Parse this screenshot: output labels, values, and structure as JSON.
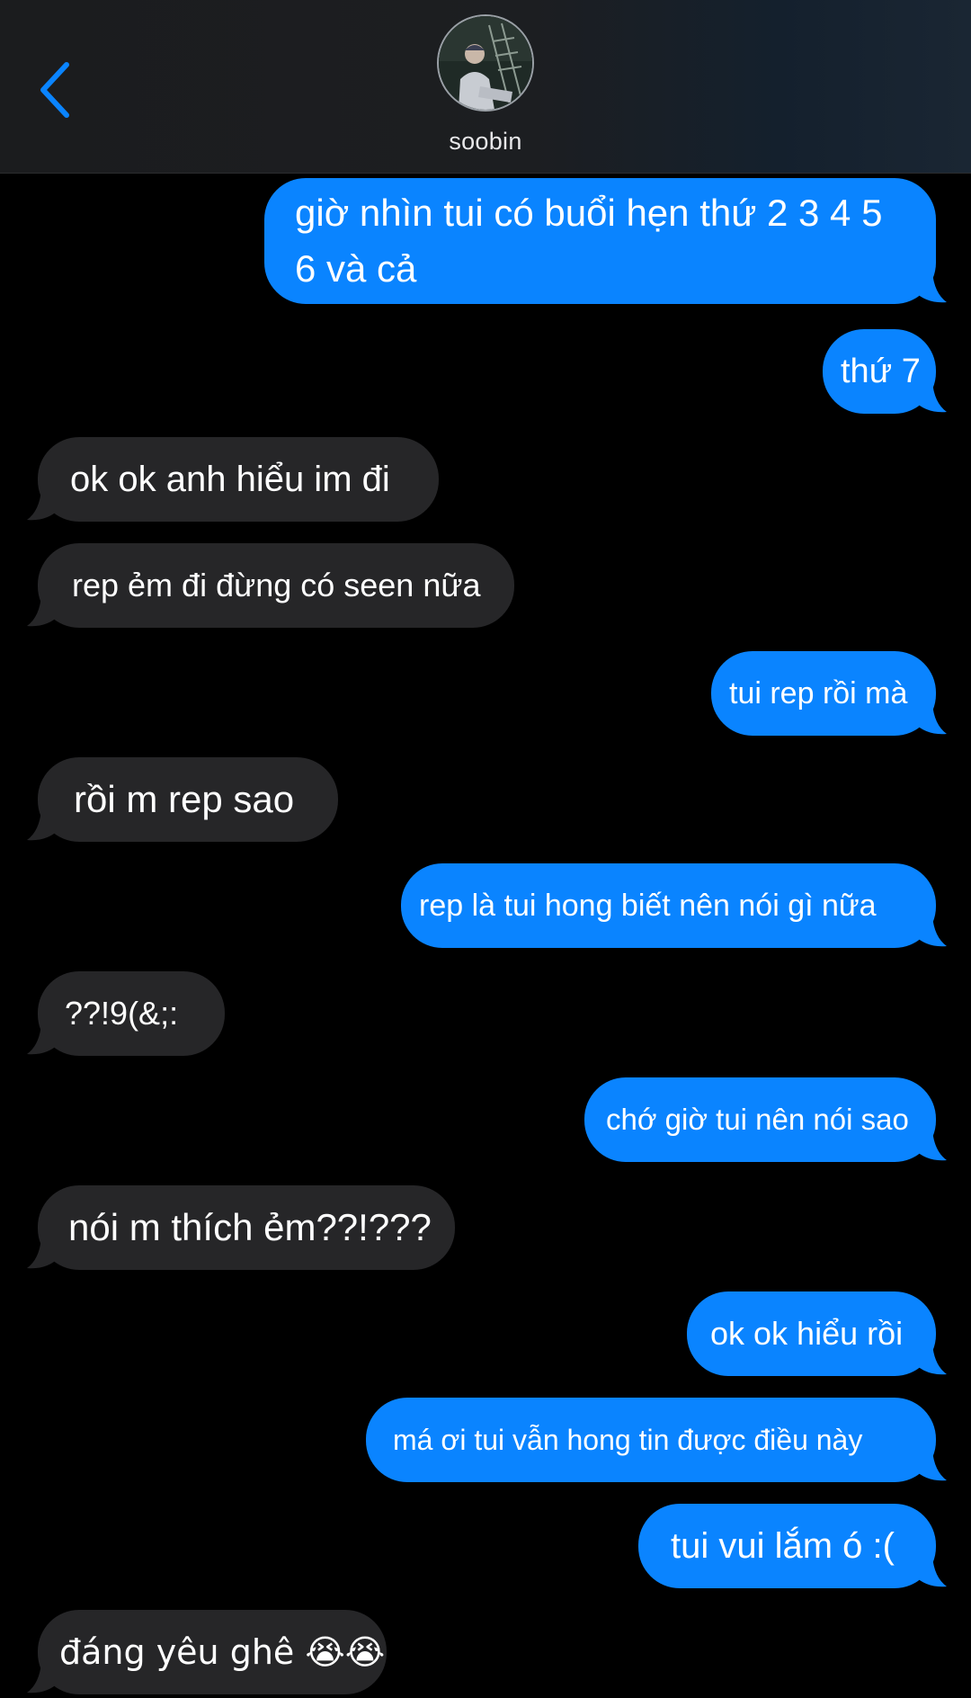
{
  "header": {
    "contact_name": "soobin"
  },
  "messages": [
    {
      "side": "sent",
      "text": "giờ nhìn tui có buổi hẹn thứ 2 3 4 5 6 và cả"
    },
    {
      "side": "sent",
      "text": "thứ 7"
    },
    {
      "side": "recv",
      "text": "ok ok anh hiểu im đi"
    },
    {
      "side": "recv",
      "text": "rep ẻm đi đừng có seen nữa"
    },
    {
      "side": "sent",
      "text": "tui rep rồi mà"
    },
    {
      "side": "recv",
      "text": "rồi m rep sao"
    },
    {
      "side": "sent",
      "text": "rep là tui hong biết nên nói gì nữa"
    },
    {
      "side": "recv",
      "text": "??!9(&;:"
    },
    {
      "side": "sent",
      "text": "chớ giờ tui nên nói sao"
    },
    {
      "side": "recv",
      "text": "nói m thích ẻm??!???"
    },
    {
      "side": "sent",
      "text": "ok ok hiểu rồi"
    },
    {
      "side": "sent",
      "text": "má ơi tui vẫn hong tin được điều này"
    },
    {
      "side": "sent",
      "text": "tui vui lắm ó :("
    },
    {
      "side": "recv",
      "text": "đáng yêu ghê 😭😭"
    }
  ],
  "colors": {
    "sent_bubble": "#0a84ff",
    "recv_bubble": "#262628",
    "background": "#000000",
    "accent": "#0a84ff"
  },
  "icons": {
    "back": "chevron-left-icon",
    "avatar": "contact-avatar"
  }
}
